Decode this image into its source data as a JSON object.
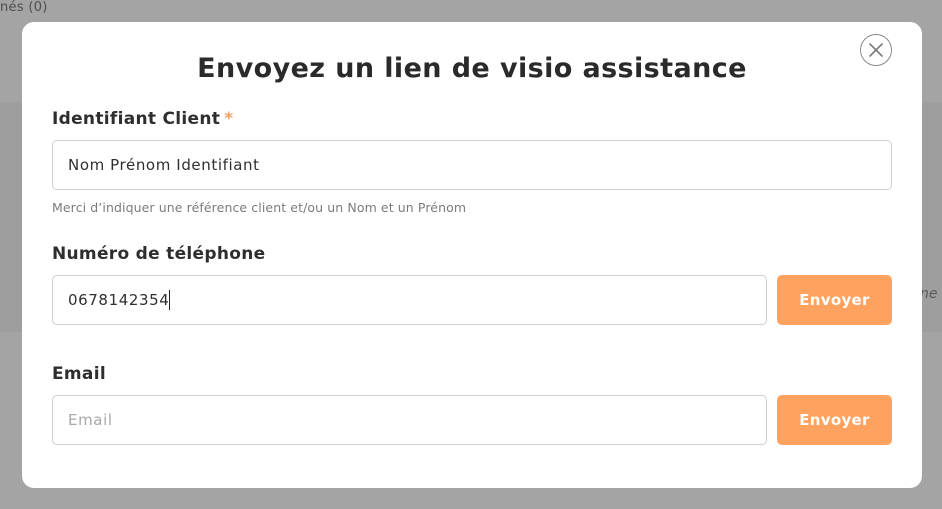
{
  "background": {
    "top_left_text": "nés (0)",
    "right_text": "ne s"
  },
  "modal": {
    "title": "Envoyez un lien de visio assistance",
    "close_icon": "close-circle-icon",
    "client_id": {
      "label": "Identifiant Client",
      "required_marker": "*",
      "value": "Nom Prénom Identifiant",
      "help": "Merci d’indiquer une référence client et/ou un Nom et un Prénom"
    },
    "phone": {
      "label": "Numéro de téléphone",
      "value": "0678142354",
      "send_label": "Envoyer"
    },
    "email": {
      "label": "Email",
      "placeholder": "Email",
      "value": "",
      "send_label": "Envoyer"
    }
  },
  "colors": {
    "accent": "#ffa260",
    "required": "#f5a05f",
    "overlay": "#a4a4a4"
  }
}
